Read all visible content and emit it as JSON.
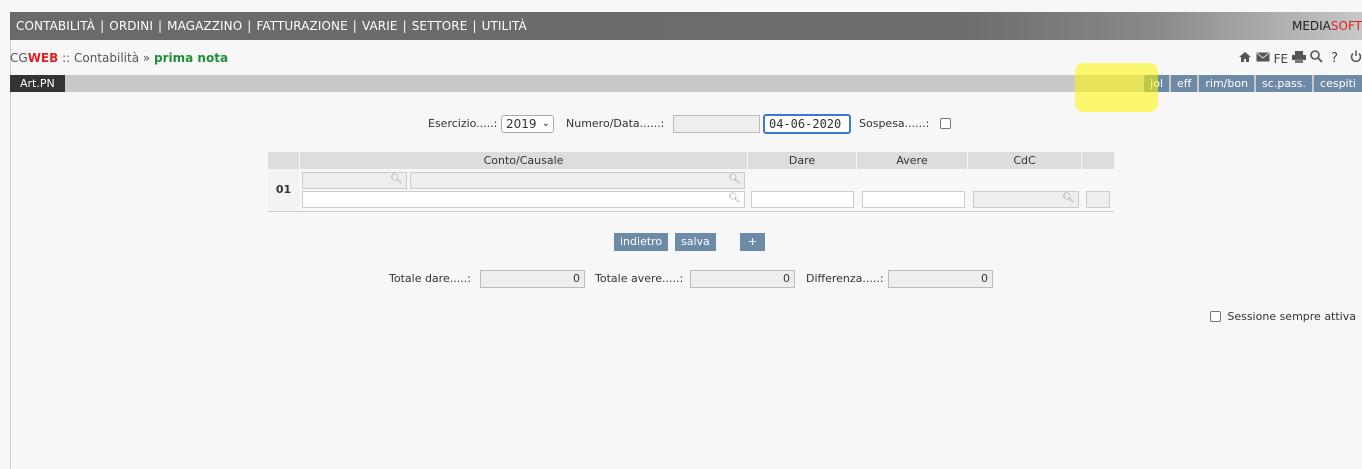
{
  "topmenu": {
    "items": [
      "CONTABILITÀ",
      "ORDINI",
      "MAGAZZINO",
      "FATTURAZIONE",
      "VARIE",
      "SETTORE",
      "UTILITÀ"
    ],
    "brand_a": "MEDIA",
    "brand_b": "SOFT"
  },
  "breadcrumb": {
    "cg": "CG",
    "web": "WEB",
    "sep": " :: Contabilità » ",
    "current": "prima nota"
  },
  "toolbar": {
    "icons": [
      "home-icon",
      "mail-icon",
      "fe-text",
      "print-icon",
      "search-icon",
      "help-icon",
      "power-icon"
    ],
    "fe_label": "FE",
    "help_label": "?"
  },
  "subbar": {
    "left_label": "Art.PN",
    "tabs": [
      "jol",
      "eff",
      "rim/bon",
      "sc.pass.",
      "cespiti"
    ]
  },
  "form": {
    "esercizio_label": "Esercizio.....:",
    "esercizio_value": "2019",
    "numero_label": "Numero/Data......:",
    "numero_value": "",
    "data_value": "04-06-2020",
    "sospesa_label": "Sospesa......:"
  },
  "grid": {
    "headers": [
      "Conto/Causale",
      "Dare",
      "Avere",
      "CdC"
    ],
    "row_number": "01"
  },
  "buttons": {
    "indietro": "indietro",
    "salva": "salva",
    "plus": "+"
  },
  "totals": {
    "dare_label": "Totale dare.....:",
    "dare_value": "0",
    "avere_label": "Totale avere.....:",
    "avere_value": "0",
    "diff_label": "Differenza.....:",
    "diff_value": "0"
  },
  "session": {
    "label": "Sessione sempre attiva"
  },
  "colors": {
    "accent": "#6d8aa6",
    "brand_red": "#e02020",
    "current_green": "#1f8f3a",
    "highlight": "#fffa00"
  }
}
